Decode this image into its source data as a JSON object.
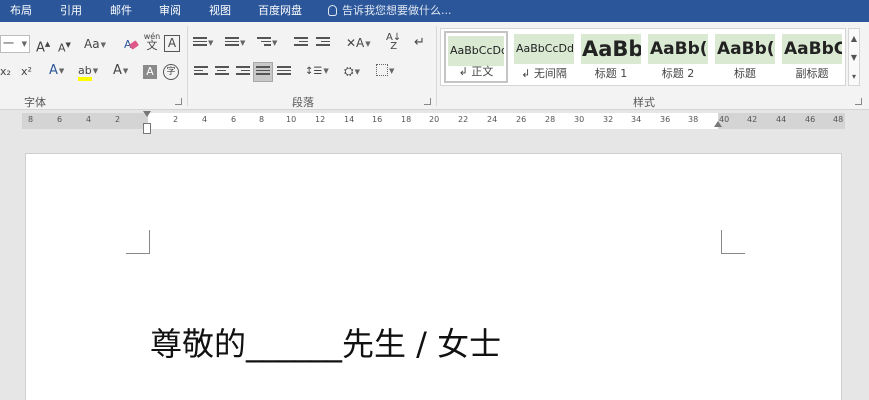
{
  "tabs": [
    "布局",
    "引用",
    "邮件",
    "审阅",
    "视图",
    "百度网盘"
  ],
  "tell_me": "告诉我您想要做什么...",
  "font_group": {
    "label": "字体",
    "font_size_value": "一",
    "grow_font": "A",
    "shrink_font": "A",
    "change_case": "Aa",
    "phonetic_guide": "wén",
    "character_border": "A",
    "subscript": "x₂",
    "superscript": "x²",
    "text_effects": "A",
    "highlight": "ab",
    "font_color": "A",
    "character_shading": "A",
    "enclose_character": "字",
    "highlight_color": "#ffff00",
    "font_color_value": "#c00000"
  },
  "paragraph_group": {
    "label": "段落"
  },
  "styles_group": {
    "label": "样式",
    "styles": [
      {
        "preview": "AaBbCcDd",
        "name": "正文",
        "selected": true
      },
      {
        "preview": "AaBbCcDd",
        "name": "无间隔",
        "selected": false
      },
      {
        "preview": "AaBb",
        "name": "标题 1",
        "selected": false
      },
      {
        "preview": "AaBb(",
        "name": "标题 2",
        "selected": false
      },
      {
        "preview": "AaBb(",
        "name": "标题",
        "selected": false
      },
      {
        "preview": "AaBbC",
        "name": "副标题",
        "selected": false
      }
    ]
  },
  "ruler": {
    "left_ticks": [
      "8",
      "6",
      "4",
      "2"
    ],
    "right_ticks": [
      "2",
      "4",
      "6",
      "8",
      "10",
      "12",
      "14",
      "16",
      "18",
      "20",
      "22",
      "24",
      "26",
      "28",
      "30",
      "32",
      "34",
      "36",
      "38",
      "40",
      "42",
      "44",
      "46",
      "48"
    ]
  },
  "document": {
    "line1": "尊敬的______先生 / 女士"
  },
  "colors": {
    "tab_bar": "#2b579a",
    "ribbon_bg": "#f3f3f3",
    "style_preview_bg": "#d9e9d2",
    "workspace": "#e6e6e6"
  }
}
